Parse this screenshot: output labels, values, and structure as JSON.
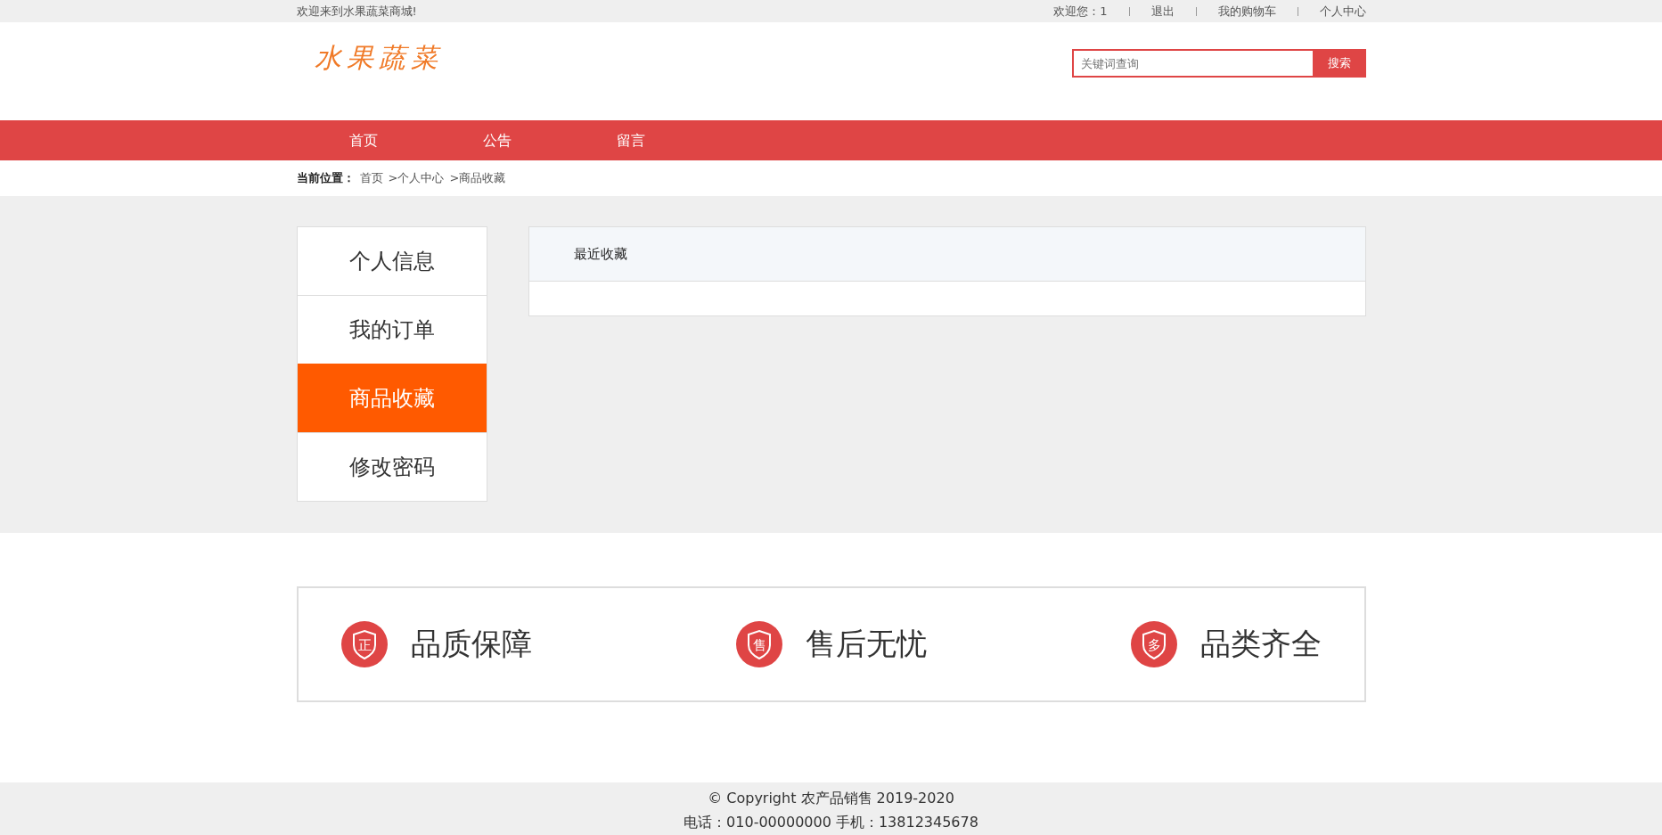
{
  "top_bar": {
    "welcome": "欢迎来到水果蔬菜商城!",
    "links": [
      {
        "label": "欢迎您：1"
      },
      {
        "label": "退出"
      },
      {
        "label": "我的购物车"
      },
      {
        "label": "个人中心"
      }
    ]
  },
  "header": {
    "logo": "水果蔬菜",
    "search": {
      "placeholder": "关键词查询",
      "button": "搜索"
    }
  },
  "nav": [
    {
      "label": "首页"
    },
    {
      "label": "公告"
    },
    {
      "label": "留言"
    }
  ],
  "breadcrumb": {
    "label": "当前位置：",
    "items": [
      "首页",
      ">个人中心",
      ">商品收藏"
    ]
  },
  "sidebar": [
    {
      "label": "个人信息",
      "selected": false
    },
    {
      "label": "我的订单",
      "selected": false
    },
    {
      "label": "商品收藏",
      "selected": true
    },
    {
      "label": "修改密码",
      "selected": false
    }
  ],
  "panel": {
    "title": "最近收藏"
  },
  "features": [
    {
      "icon_text": "正",
      "label": "品质保障"
    },
    {
      "icon_text": "售",
      "label": "售后无忧"
    },
    {
      "icon_text": "多",
      "label": "品类齐全"
    }
  ],
  "footer": {
    "copyright": "© Copyright 农产品销售 2019-2020",
    "contact": "电话：010-00000000 手机：13812345678"
  }
}
